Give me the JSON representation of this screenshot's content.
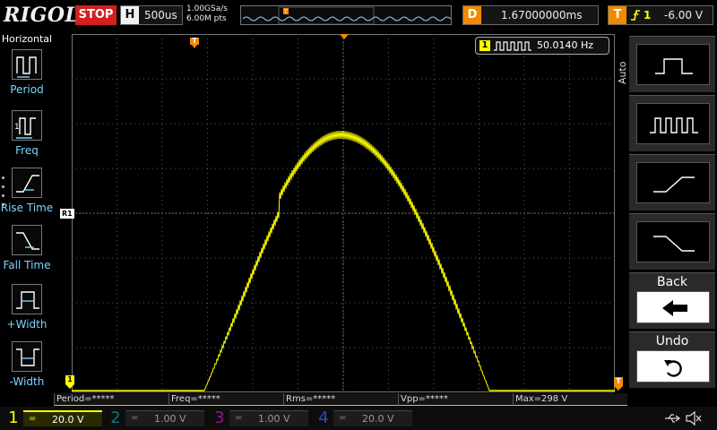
{
  "header": {
    "brand": "RIGOL",
    "run_status": "STOP",
    "horizontal": {
      "key": "H",
      "timebase": "500us"
    },
    "acquisition": {
      "sample_rate": "1.00GSa/s",
      "memory_depth": "6.00M pts"
    },
    "delay": {
      "key": "D",
      "value": "1.67000000ms"
    },
    "trigger": {
      "key": "T",
      "slope_icon": "rising-edge-icon",
      "source": "1",
      "level": "-6.00 V"
    }
  },
  "left_menu": {
    "title": "Horizontal",
    "items": [
      {
        "label": "Period",
        "icon": "period-measure-icon"
      },
      {
        "label": "Freq",
        "icon": "frequency-measure-icon"
      },
      {
        "label": "Rise Time",
        "icon": "rise-time-icon"
      },
      {
        "label": "Fall Time",
        "icon": "fall-time-icon"
      },
      {
        "label": "+Width",
        "icon": "positive-width-icon"
      },
      {
        "label": "-Width",
        "icon": "negative-width-icon"
      }
    ]
  },
  "screen": {
    "frequency_counter": {
      "channel": "1",
      "value": "50.0140 Hz"
    },
    "markers": {
      "trigger_position": "T",
      "ref_marker": "R1",
      "channel_ground": "1",
      "trigger_level": "T"
    }
  },
  "right_menu": {
    "mode_label": "Auto",
    "items": [
      {
        "label": "",
        "icon": "square-wave-single-icon"
      },
      {
        "label": "",
        "icon": "square-wave-multi-icon"
      },
      {
        "label": "",
        "icon": "rising-ramp-icon"
      },
      {
        "label": "",
        "icon": "falling-ramp-icon"
      },
      {
        "label": "Back",
        "icon": "left-arrow-icon"
      },
      {
        "label": "Undo",
        "icon": "undo-icon"
      }
    ]
  },
  "measurements": [
    {
      "label": "Period=*****"
    },
    {
      "label": "Freq=*****"
    },
    {
      "label": "Rms=*****"
    },
    {
      "label": "Vpp=*****"
    },
    {
      "label": "Max=298 V"
    }
  ],
  "channels": [
    {
      "num": "1",
      "coupling": "=",
      "scale": "20.0 V",
      "color": "#ffff00",
      "active": true
    },
    {
      "num": "2",
      "coupling": "=",
      "scale": "1.00 V",
      "color": "#00c8c8",
      "active": false
    },
    {
      "num": "3",
      "coupling": "=",
      "scale": "1.00 V",
      "color": "#e030e0",
      "active": false
    },
    {
      "num": "4",
      "coupling": "=",
      "scale": "20.0 V",
      "color": "#3a78ff",
      "active": false
    }
  ],
  "status_icons": [
    "usb-icon",
    "speaker-muted-icon"
  ],
  "colors": {
    "ch1": "#ffff00",
    "accent_orange": "#f18a00",
    "stop_red": "#d41f1f",
    "grid": "#5a5a5a"
  }
}
